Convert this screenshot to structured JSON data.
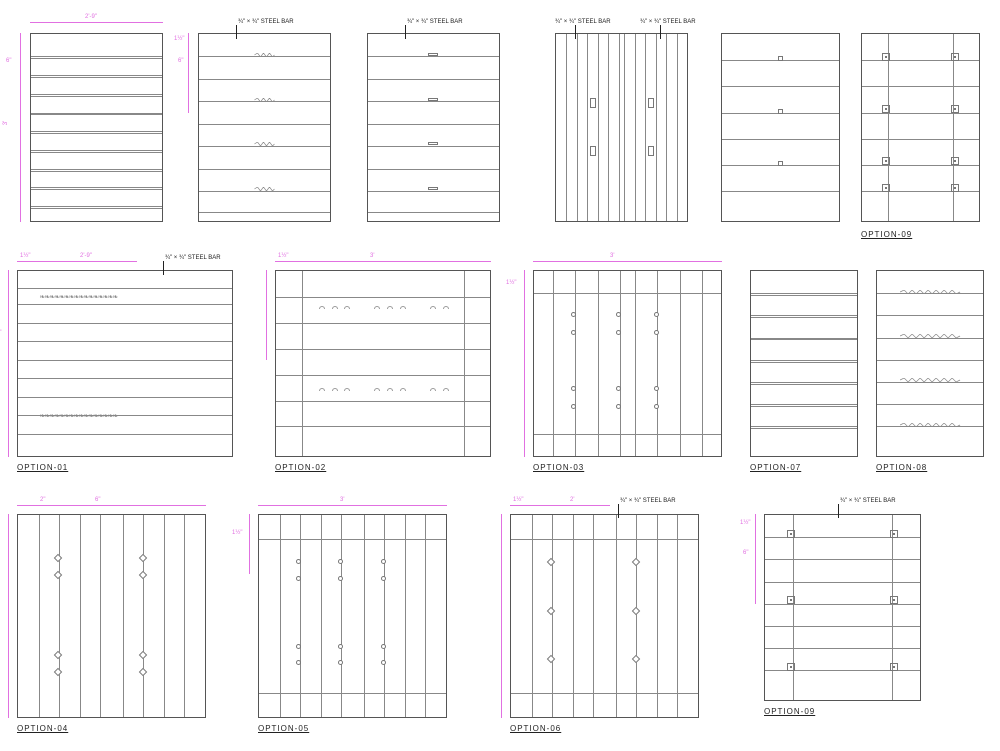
{
  "notes": {
    "steel_bar": "STEEL BAR",
    "steel_bar_prefix": "¾\" × ¾\""
  },
  "dims": {
    "width_main": "2'-9\"",
    "gap_1_5": "1½\"",
    "gap_6": "6\"",
    "gap_2": "2\"",
    "gap_3": "3'",
    "two_feet": "2'"
  },
  "labels": {
    "opt01": "OPTION-01",
    "opt02": "OPTION-02",
    "opt03": "OPTION-03",
    "opt04": "OPTION-04",
    "opt05": "OPTION-05",
    "opt06": "OPTION-06",
    "opt07": "OPTION-07",
    "opt08": "OPTION-08",
    "opt09": "OPTION-09"
  }
}
